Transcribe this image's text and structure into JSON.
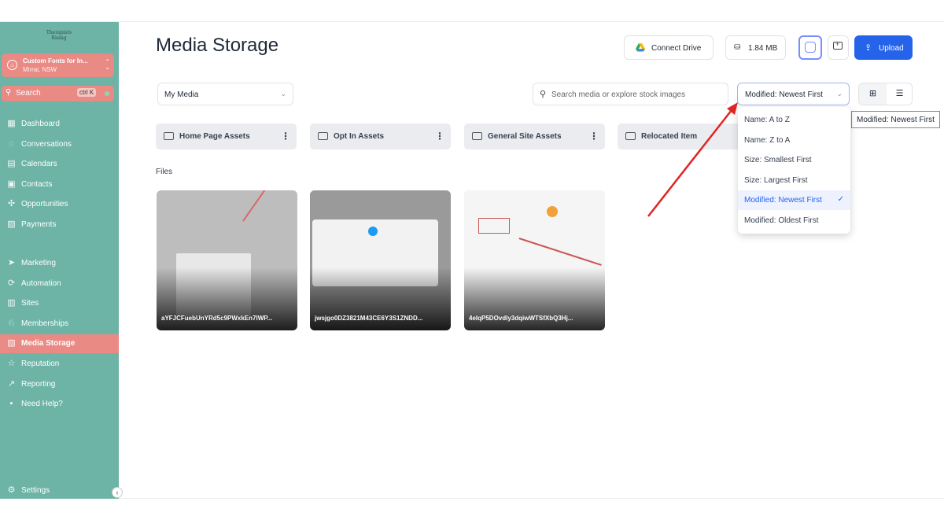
{
  "sidebar": {
    "logo_text": "Therapists Rising",
    "location": {
      "name": "Custom Fonts for In...",
      "sub": "Mirrai, NSW"
    },
    "search": {
      "label": "Search",
      "shortcut": "ctrl K"
    },
    "nav_top": [
      {
        "label": "Dashboard",
        "icon": "dashboard-icon",
        "glyph": "▦"
      },
      {
        "label": "Conversations",
        "icon": "chat-icon",
        "glyph": "◌"
      },
      {
        "label": "Calendars",
        "icon": "calendar-icon",
        "glyph": "▤"
      },
      {
        "label": "Contacts",
        "icon": "contacts-icon",
        "glyph": "▣"
      },
      {
        "label": "Opportunities",
        "icon": "opportunities-icon",
        "glyph": "✣"
      },
      {
        "label": "Payments",
        "icon": "payments-icon",
        "glyph": "▧"
      }
    ],
    "nav_bottom": [
      {
        "label": "Marketing",
        "icon": "send-icon",
        "glyph": "➤"
      },
      {
        "label": "Automation",
        "icon": "automation-icon",
        "glyph": "⟳"
      },
      {
        "label": "Sites",
        "icon": "sites-icon",
        "glyph": "▥"
      },
      {
        "label": "Memberships",
        "icon": "memberships-icon",
        "glyph": "♘"
      },
      {
        "label": "Media Storage",
        "icon": "media-icon",
        "glyph": "▨"
      },
      {
        "label": "Reputation",
        "icon": "star-icon",
        "glyph": "☆"
      },
      {
        "label": "Reporting",
        "icon": "reporting-icon",
        "glyph": "↗"
      },
      {
        "label": "Need Help?",
        "icon": "help-icon",
        "glyph": "▪"
      }
    ],
    "active": "Media Storage",
    "settings": "Settings"
  },
  "header": {
    "title": "Media Storage",
    "connect_drive": "Connect Drive",
    "storage_used": "1.84 MB",
    "upload": "Upload"
  },
  "toolbar": {
    "filter": "My Media",
    "search_placeholder": "Search media or explore stock images",
    "sort": "Modified: Newest First"
  },
  "tooltip": "Modified: Newest First",
  "folders": [
    {
      "label": "Home Page Assets"
    },
    {
      "label": "Opt In Assets"
    },
    {
      "label": "General Site Assets"
    },
    {
      "label": "Relocated Item"
    }
  ],
  "files_heading": "Files",
  "files": [
    {
      "name": "aYFJCFuebUnYRd5c9PWxkEn7lWP..."
    },
    {
      "name": "jwsjgo0DZ3821M43CE6Y3S1ZNDD..."
    },
    {
      "name": "4eIqP5DOvdly3dqiwWTSfXbQ3Hj..."
    }
  ],
  "sort_options": [
    {
      "label": "Name: A to Z",
      "selected": false
    },
    {
      "label": "Name: Z to A",
      "selected": false
    },
    {
      "label": "Size: Smallest First",
      "selected": false
    },
    {
      "label": "Size: Largest First",
      "selected": false
    },
    {
      "label": "Modified: Newest First",
      "selected": true
    },
    {
      "label": "Modified: Oldest First",
      "selected": false
    }
  ],
  "colors": {
    "sidebar": "#6db3a6",
    "sidebar_active": "#ea8a85",
    "primary": "#2563eb",
    "annotation_arrow": "#e02424"
  }
}
